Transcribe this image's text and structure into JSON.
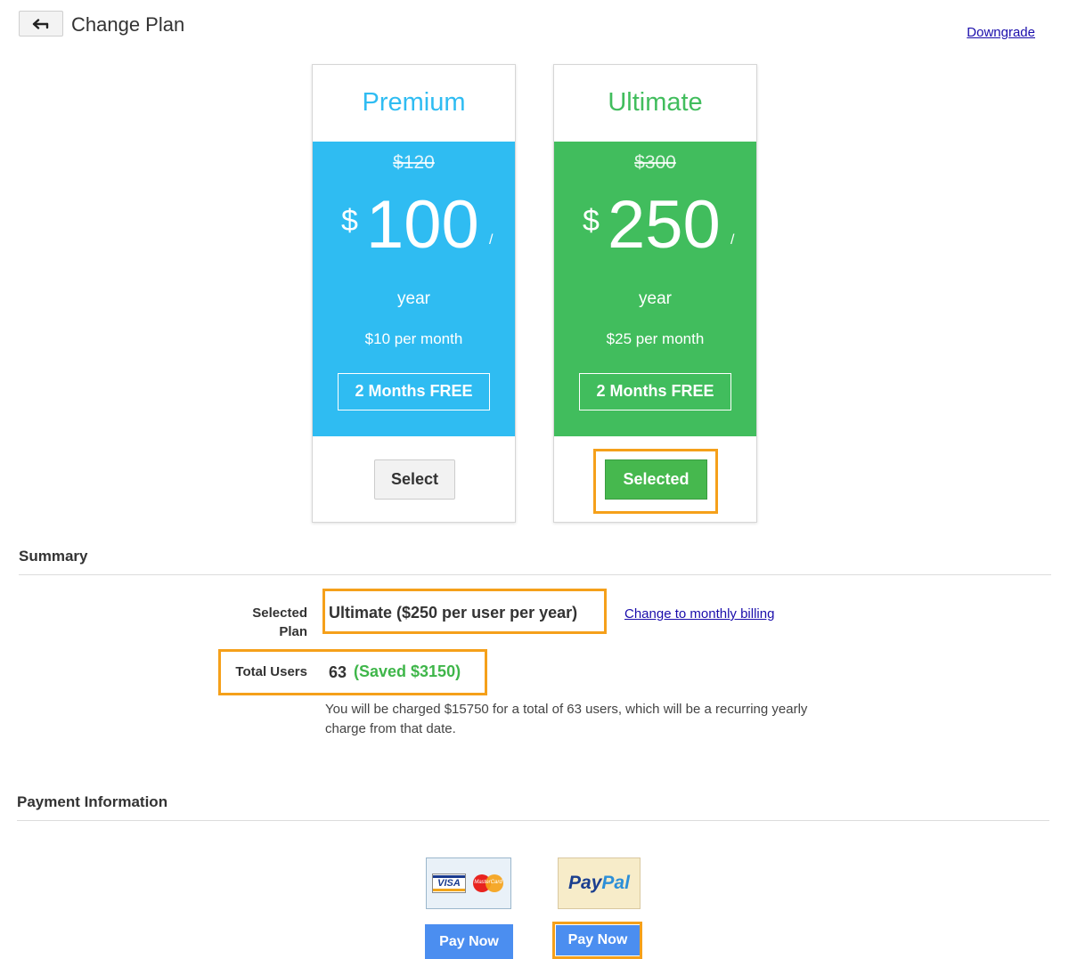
{
  "header": {
    "back_icon": "back-arrow-icon",
    "title": "Change Plan",
    "downgrade_link": "Downgrade"
  },
  "colors": {
    "premium": "#2fbcf2",
    "ultimate": "#41bd5d",
    "highlight": "#f5a01a",
    "link": "#1a0dab",
    "pay_button": "#4b8ef0"
  },
  "plans": [
    {
      "name": "Premium",
      "old_price": "$120",
      "currency": "$",
      "price": "100",
      "slash": "/",
      "period": "year",
      "monthly": "$10 per month",
      "promo": "2 Months FREE",
      "button": "Select",
      "selected": false
    },
    {
      "name": "Ultimate",
      "old_price": "$300",
      "currency": "$",
      "price": "250",
      "slash": "/",
      "period": "year",
      "monthly": "$25 per month",
      "promo": "2 Months FREE",
      "button": "Selected",
      "selected": true
    }
  ],
  "summary": {
    "title": "Summary",
    "selected_plan_label_line1": "Selected",
    "selected_plan_label_line2": "Plan",
    "selected_plan_value": "Ultimate ($250 per user per year)",
    "change_billing_link": "Change to monthly billing",
    "total_users_label": "Total Users",
    "total_users_value": "63",
    "saved_text": "(Saved $3150)",
    "charge_note": "You will be charged $15750 for a total of 63 users, which will be a recurring yearly charge from that date."
  },
  "payment": {
    "title": "Payment Information",
    "card_logo_visa": "VISA",
    "card_logo_mastercard": "MasterCard",
    "paypal_logo_pay": "Pay",
    "paypal_logo_pal": "Pal",
    "card_pay_button": "Pay Now",
    "paypal_pay_button": "Pay Now"
  }
}
